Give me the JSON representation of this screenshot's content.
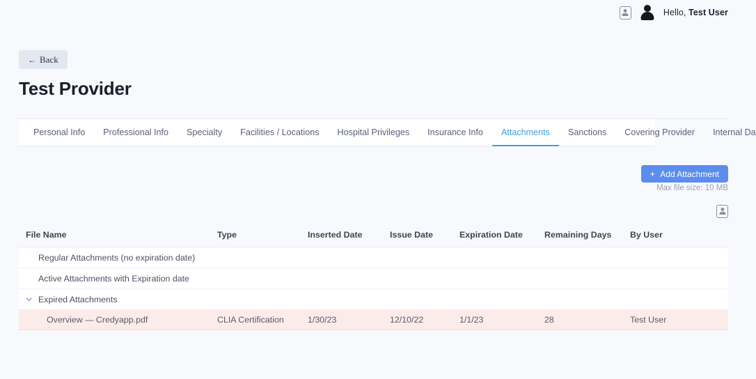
{
  "topbar": {
    "badge_icon": "id-badge-icon",
    "avatar_icon": "user-avatar-icon",
    "greeting_prefix": "Hello, ",
    "user_name": "Test User"
  },
  "back": {
    "arrow": "←",
    "label": "Back"
  },
  "header": {
    "title": "Test Provider"
  },
  "tabs": [
    {
      "label": "Personal Info",
      "active": false
    },
    {
      "label": "Professional Info",
      "active": false
    },
    {
      "label": "Specialty",
      "active": false
    },
    {
      "label": "Facilities / Locations",
      "active": false
    },
    {
      "label": "Hospital Privileges",
      "active": false
    },
    {
      "label": "Insurance Info",
      "active": false
    },
    {
      "label": "Attachments",
      "active": true
    },
    {
      "label": "Sanctions",
      "active": false
    },
    {
      "label": "Covering Provider",
      "active": false
    },
    {
      "label": "Internal Date",
      "active": false
    }
  ],
  "actions": {
    "add_plus": "+",
    "add_label": "Add Attachment",
    "max_file_size": "Max file size: 10 MB",
    "grid_icon": "id-badge-icon",
    "accent_color": "#5b8ded"
  },
  "table": {
    "columns": [
      "File Name",
      "Type",
      "Inserted Date",
      "Issue Date",
      "Expiration Date",
      "Remaining Days",
      "By User"
    ],
    "groups": [
      {
        "label": "Regular Attachments (no expiration date)",
        "expandable": false,
        "expanded": false
      },
      {
        "label": "Active Attachments with Expiration date",
        "expandable": false,
        "expanded": false
      },
      {
        "label": "Expired Attachments",
        "expandable": true,
        "expanded": true
      }
    ],
    "rows": [
      {
        "file_name": "Overview — Credyapp.pdf",
        "type": "CLIA Certification",
        "inserted_date": "1/30/23",
        "issue_date": "12/10/22",
        "expiration_date": "1/1/23",
        "remaining_days": "28",
        "by_user": "Test User",
        "state": "expired",
        "row_color": "#fcebe9"
      }
    ]
  }
}
